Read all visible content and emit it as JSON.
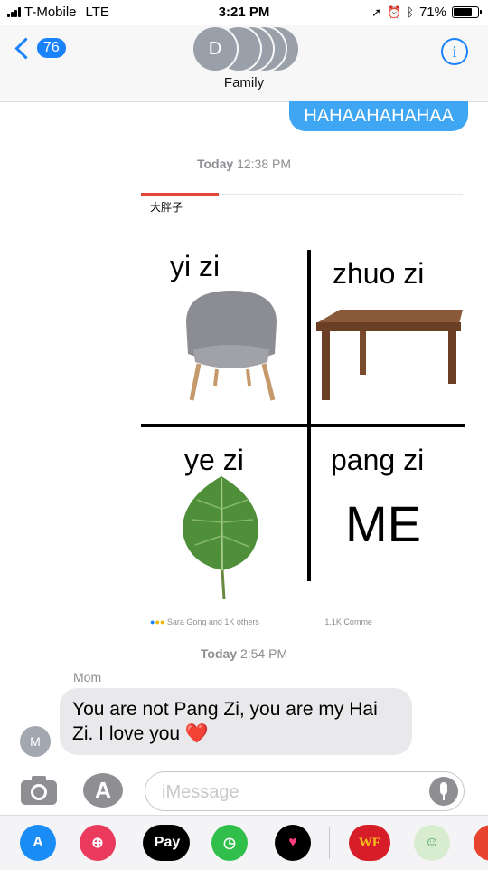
{
  "status": {
    "carrier": "T-Mobile",
    "network": "LTE",
    "time": "3:21 PM",
    "battery": "71%",
    "battery_level": 0.71
  },
  "header": {
    "back_count": "76",
    "group_initial": "D",
    "group_name": "Family",
    "info_glyph": "i"
  },
  "messages": {
    "sent_text": "HAHAAHAHAHAA",
    "stamp1_day": "Today",
    "stamp1_time": "12:38 PM",
    "image": {
      "caption": "大胖子",
      "q1": "yi zi",
      "q2": "zhuo zi",
      "q3": "ye zi",
      "q4": "pang zi",
      "me": "ME",
      "reaction_left": "Sara Gong and 1K others",
      "reaction_right": "1.1K Comme"
    },
    "stamp2_day": "Today",
    "stamp2_time": "2:54 PM",
    "sender": "Mom",
    "sender_initial": "M",
    "received_text": "You are not Pang Zi, you are my Hai Zi. I love you ❤️"
  },
  "input": {
    "placeholder": "iMessage"
  },
  "apps": {
    "pay_label": "Pay",
    "wf_label": "WF"
  },
  "colors": {
    "blue": "#1a82fb",
    "bubble_blue": "#3fa6f3",
    "bubble_grey": "#e9e9eb"
  }
}
